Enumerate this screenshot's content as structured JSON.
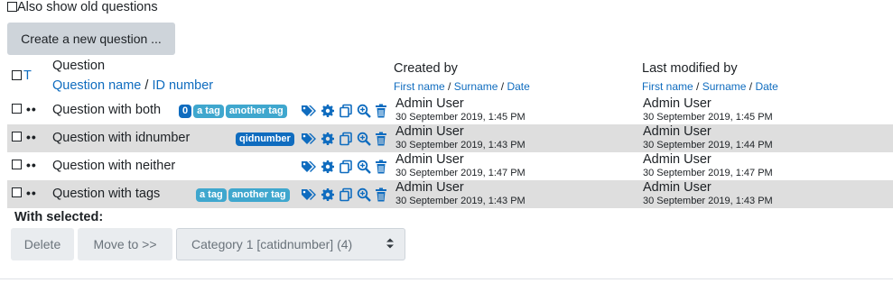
{
  "show_old_label": "Also show old questions",
  "create_button": "Create a new question ...",
  "header": {
    "type_sort": "T",
    "question": "Question",
    "question_name": "Question name",
    "slash": "/",
    "id_number": "ID number",
    "created_by": "Created by",
    "last_modified_by": "Last modified by",
    "first_name": "First name",
    "surname": "Surname",
    "date": "Date"
  },
  "rows": [
    {
      "name": "Question with both",
      "idnumber": "0",
      "tags": [
        "a tag",
        "another tag"
      ],
      "created_user": "Admin User",
      "created_date": "30 September 2019, 1:45 PM",
      "modified_user": "Admin User",
      "modified_date": "30 September 2019, 1:45 PM"
    },
    {
      "name": "Question with idnumber",
      "idnumber": "qidnumber",
      "tags": [],
      "created_user": "Admin User",
      "created_date": "30 September 2019, 1:43 PM",
      "modified_user": "Admin User",
      "modified_date": "30 September 2019, 1:44 PM"
    },
    {
      "name": "Question with neither",
      "tags": [],
      "created_user": "Admin User",
      "created_date": "30 September 2019, 1:47 PM",
      "modified_user": "Admin User",
      "modified_date": "30 September 2019, 1:47 PM"
    },
    {
      "name": "Question with tags",
      "tags": [
        "a tag",
        "another tag"
      ],
      "created_user": "Admin User",
      "created_date": "30 September 2019, 1:43 PM",
      "modified_user": "Admin User",
      "modified_date": "30 September 2019, 1:43 PM"
    }
  ],
  "row_icons": [
    "tags-icon",
    "gear-icon",
    "duplicate-icon",
    "preview-icon",
    "delete-icon"
  ],
  "with_selected": "With selected:",
  "delete_button": "Delete",
  "move_button": "Move to >>",
  "category_select": "Category 1 [catidnumber] (4)",
  "colors": {
    "link": "#0f6cbf",
    "tag": "#3fa7ce",
    "idtag": "#0f6cbf",
    "shade": "#dedede"
  }
}
